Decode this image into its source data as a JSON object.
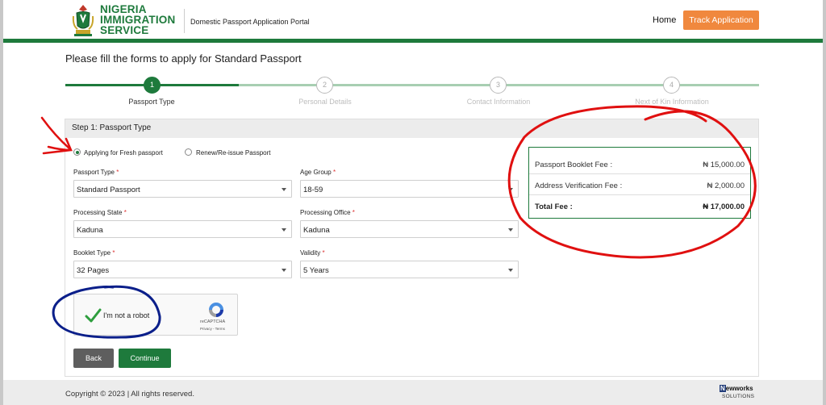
{
  "colors": {
    "brand_green": "#1e7a3c",
    "accent_orange": "#f0883e",
    "annotation_red": "#e01010",
    "annotation_blue": "#0b1f8a"
  },
  "header": {
    "logo_lines": [
      "NIGERIA",
      "IMMIGRATION",
      "SERVICE"
    ],
    "portal_name": "Domestic Passport Application Portal",
    "nav_home": "Home",
    "track_button": "Track Application"
  },
  "main": {
    "title": "Please fill the forms to apply for Standard Passport",
    "steps": [
      {
        "number": "1",
        "label": "Passport Type",
        "active": true
      },
      {
        "number": "2",
        "label": "Personal Details",
        "active": false
      },
      {
        "number": "3",
        "label": "Contact Information",
        "active": false
      },
      {
        "number": "4",
        "label": "Next of Kin Information",
        "active": false
      }
    ],
    "card_title": "Step 1: Passport Type",
    "radio_fresh": "Applying for Fresh passport",
    "radio_renew": "Renew/Re-issue Passport",
    "fields": {
      "passport_type": {
        "label": "Passport Type",
        "required": "*",
        "value": "Standard Passport"
      },
      "age_group": {
        "label": "Age Group",
        "required": "*",
        "value": "18-59"
      },
      "processing_state": {
        "label": "Processing State",
        "required": "*",
        "value": "Kaduna"
      },
      "processing_office": {
        "label": "Processing Office",
        "required": "*",
        "value": "Kaduna"
      },
      "booklet_type": {
        "label": "Booklet Type",
        "required": "*",
        "value": "32 Pages"
      },
      "validity": {
        "label": "Validity",
        "required": "*",
        "value": "5 Years"
      }
    },
    "captcha": {
      "label": "I'm not a robot",
      "brand": "reCAPTCHA",
      "links": "Privacy - Terms"
    },
    "back_button": "Back",
    "continue_button": "Continue",
    "fees": [
      {
        "name": "Passport Booklet Fee :",
        "amount": "₦ 15,000.00"
      },
      {
        "name": "Address Verification Fee :",
        "amount": "₦ 2,000.00"
      },
      {
        "name": "Total Fee :",
        "amount": "₦ 17,000.00"
      }
    ]
  },
  "footer": {
    "copyright": "Copyright © 2023 | All rights reserved.",
    "vendor_top": "ewworks",
    "vendor_n": "N",
    "vendor_bottom": "SOLUTIONS"
  }
}
